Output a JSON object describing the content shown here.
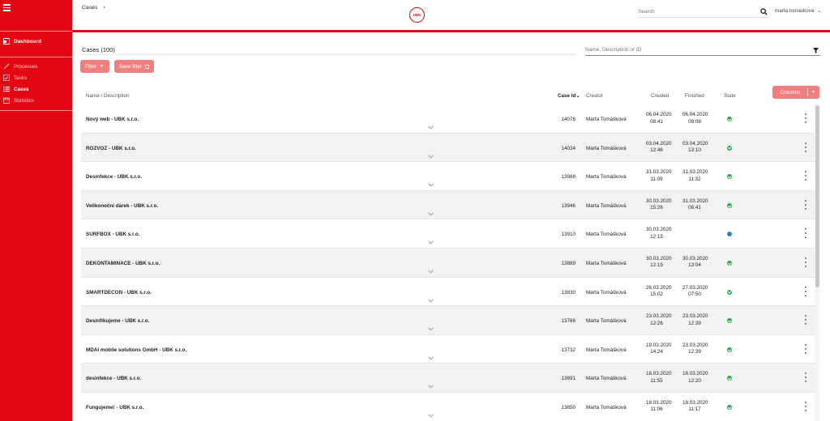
{
  "sidebar": {
    "dashboard": "Dashboard",
    "items": [
      {
        "label": "Processes",
        "icon": "wand-icon",
        "active": false
      },
      {
        "label": "Tasks",
        "icon": "check-square-icon",
        "active": false
      },
      {
        "label": "Cases",
        "icon": "list-icon",
        "active": true
      },
      {
        "label": "Statistics",
        "icon": "calendar-icon",
        "active": false
      }
    ]
  },
  "header": {
    "breadcrumb": "Cases",
    "logo_text": "UBK",
    "search_placeholder": "Search",
    "user": "marta.tomaskova"
  },
  "toolbar": {
    "title": "Cases (100)",
    "filter_placeholder": "Name, Description or ID",
    "filter_label": "Filter",
    "save_filter_label": "Save filter",
    "columns_label": "Columns"
  },
  "table": {
    "columns": {
      "name": "Name / Description",
      "case_id": "Case Id",
      "creator": "Creator",
      "created": "Created",
      "finished": "Finished",
      "state": "State"
    },
    "rows": [
      {
        "name": "Nový web - UBK s.r.o.",
        "id": "14076",
        "creator": "Marta Tomášková",
        "created_date": "06.04.2020",
        "created_time": "08:41",
        "finished_date": "06.04.2020",
        "finished_time": "09:08",
        "state": "done"
      },
      {
        "name": "ROZVOZ - UBK s.r.o.",
        "id": "14034",
        "creator": "Marta Tomášková",
        "created_date": "03.04.2020",
        "created_time": "12:46",
        "finished_date": "03.04.2020",
        "finished_time": "13:10",
        "state": "done"
      },
      {
        "name": "Desinfekce - UBK s.r.o.",
        "id": "13988",
        "creator": "Marta Tomášková",
        "created_date": "31.03.2020",
        "created_time": "11:09",
        "finished_date": "31.03.2020",
        "finished_time": "11:32",
        "state": "done"
      },
      {
        "name": "Velikonoční dárek - UBK s.r.o.",
        "id": "13946",
        "creator": "Marta Tomášková",
        "created_date": "30.03.2020",
        "created_time": "15:26",
        "finished_date": "31.03.2020",
        "finished_time": "08:41",
        "state": "done"
      },
      {
        "name": "SURFBOX - UBK s.r.o.",
        "id": "13910",
        "creator": "Marta Tomášková",
        "created_date": "30.03.2020",
        "created_time": "12:15",
        "finished_date": "",
        "finished_time": "",
        "state": "running"
      },
      {
        "name": "DEKONTAMINACE - UBK s.r.o.",
        "id": "13889",
        "creator": "Marta Tomášková",
        "created_date": "30.03.2020",
        "created_time": "12:15",
        "finished_date": "30.03.2020",
        "finished_time": "13:04",
        "state": "done"
      },
      {
        "name": "SMARTDECON - UBK s.r.o.",
        "id": "13830",
        "creator": "Marta Tomášková",
        "created_date": "26.03.2020",
        "created_time": "15:02",
        "finished_date": "27.03.2020",
        "finished_time": "07:50",
        "state": "done"
      },
      {
        "name": "Desinfikujeme - UBK s.r.o.",
        "id": "13766",
        "creator": "Marta Tomášková",
        "created_date": "23.03.2020",
        "created_time": "12:26",
        "finished_date": "23.03.2020",
        "finished_time": "12:39",
        "state": "done"
      },
      {
        "name": "MDAI mobile solutions GmbH - UBK s.r.o.",
        "id": "13732",
        "creator": "Marta Tomášková",
        "created_date": "19.03.2020",
        "created_time": "14:24",
        "finished_date": "23.03.2020",
        "finished_time": "12:39",
        "state": "done"
      },
      {
        "name": "desinfekce - UBK s.r.o.",
        "id": "13691",
        "creator": "Marta Tomášková",
        "created_date": "18.03.2020",
        "created_time": "11:55",
        "finished_date": "18.03.2020",
        "finished_time": "12:20",
        "state": "done"
      },
      {
        "name": "Fungujeme! - UBK s.r.o.",
        "id": "13650",
        "creator": "Marta Tomášková",
        "created_date": "18.03.2020",
        "created_time": "11:06",
        "finished_date": "18.03.2020",
        "finished_time": "11:17",
        "state": "done"
      }
    ]
  },
  "colors": {
    "brand": "#e30613",
    "button": "#f08080",
    "state_done": "#22aa44",
    "state_running": "#2d7fd3"
  }
}
